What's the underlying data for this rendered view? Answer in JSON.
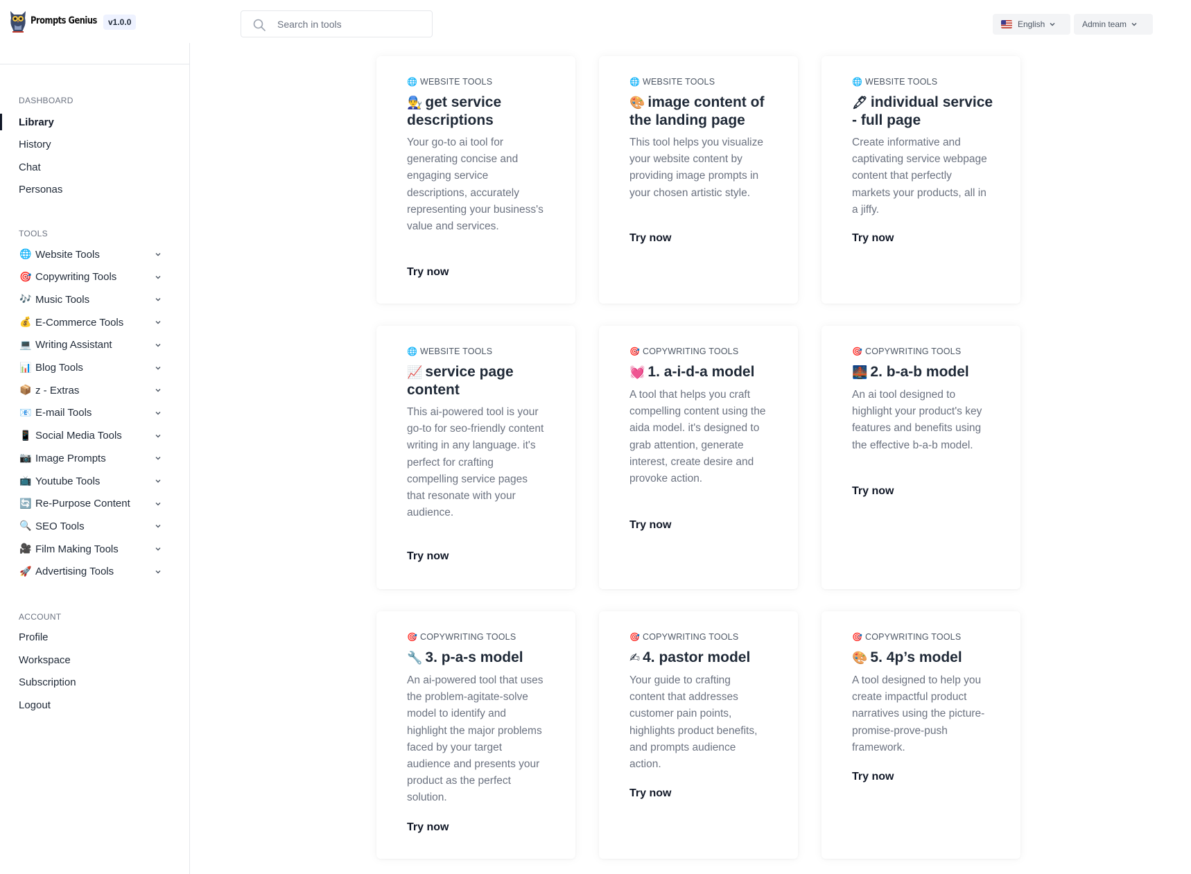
{
  "header": {
    "brand_name": "Prompts Genius",
    "version": "v1.0.0",
    "search_placeholder": "Search in tools",
    "language": "English",
    "team": "Admin team"
  },
  "sidebar": {
    "dashboard_title": "DASHBOARD",
    "dashboard_items": [
      "Library",
      "History",
      "Chat",
      "Personas"
    ],
    "tools_title": "TOOLS",
    "tools": [
      {
        "emoji": "🌐",
        "label": "Website Tools"
      },
      {
        "emoji": "🎯",
        "label": "Copywriting Tools"
      },
      {
        "emoji": "🎶",
        "label": "Music Tools"
      },
      {
        "emoji": "💰",
        "label": "E-Commerce Tools"
      },
      {
        "emoji": "💻",
        "label": "Writing Assistant"
      },
      {
        "emoji": "📊",
        "label": "Blog Tools"
      },
      {
        "emoji": "📦",
        "label": "z - Extras"
      },
      {
        "emoji": "📧",
        "label": "E-mail Tools"
      },
      {
        "emoji": "📱",
        "label": "Social Media Tools"
      },
      {
        "emoji": "📷",
        "label": "Image Prompts"
      },
      {
        "emoji": "📺",
        "label": "Youtube Tools"
      },
      {
        "emoji": "🔄",
        "label": "Re-Purpose Content"
      },
      {
        "emoji": "🔍",
        "label": "SEO Tools"
      },
      {
        "emoji": "🎥",
        "label": "Film Making Tools"
      },
      {
        "emoji": "🚀",
        "label": "Advertising Tools"
      }
    ],
    "account_title": "ACCOUNT",
    "account_items": [
      "Profile",
      "Workspace",
      "Subscription",
      "Logout"
    ]
  },
  "cards": [
    {
      "cat_emoji": "🌐",
      "category": "WEBSITE TOOLS",
      "emoji": "👨‍🔧",
      "title": "get service descriptions",
      "desc": "Your go-to ai tool for generating concise and engaging service descriptions, accurately representing your business's value and services.",
      "cta": "Try now"
    },
    {
      "cat_emoji": "🌐",
      "category": "WEBSITE TOOLS",
      "emoji": "🎨",
      "title": "image content of the landing page",
      "desc": "This tool helps you visualize your website content by providing image prompts in your chosen artistic style.",
      "cta": "Try now"
    },
    {
      "cat_emoji": "🌐",
      "category": "WEBSITE TOOLS",
      "emoji": "🖋",
      "title": "individual service - full page",
      "desc": "Create informative and captivating service webpage content that perfectly markets your products, all in a jiffy.",
      "cta": "Try now"
    },
    {
      "cat_emoji": "🌐",
      "category": "WEBSITE TOOLS",
      "emoji": "📈",
      "title": "service page content",
      "desc": "This ai-powered tool is your go-to for seo-friendly content writing in any language. it's perfect for crafting compelling service pages that resonate with your audience.",
      "cta": "Try now"
    },
    {
      "cat_emoji": "🎯",
      "category": "COPYWRITING TOOLS",
      "emoji": "💓",
      "title": "1. a-i-d-a model",
      "desc": "A tool that helps you craft compelling content using the aida model. it's designed to grab attention, generate interest, create desire and provoke action.",
      "cta": "Try now"
    },
    {
      "cat_emoji": "🎯",
      "category": "COPYWRITING TOOLS",
      "emoji": "🌉",
      "title": "2. b-a-b model",
      "desc": "An ai tool designed to highlight your product's key features and benefits using the effective b-a-b model.",
      "cta": "Try now"
    },
    {
      "cat_emoji": "🎯",
      "category": "COPYWRITING TOOLS",
      "emoji": "🔧",
      "title": "3. p-a-s model",
      "desc": "An ai-powered tool that uses the problem-agitate-solve model to identify and highlight the major problems faced by your target audience and presents your product as the perfect solution.",
      "cta": "Try now"
    },
    {
      "cat_emoji": "🎯",
      "category": "COPYWRITING TOOLS",
      "emoji": "✍",
      "title": "4. pastor model",
      "desc": "Your guide to crafting content that addresses customer pain points, highlights product benefits, and prompts audience action.",
      "cta": "Try now"
    },
    {
      "cat_emoji": "🎯",
      "category": "COPYWRITING TOOLS",
      "emoji": "🎨",
      "title": "5. 4p’s model",
      "desc": "A tool designed to help you create impactful product narratives using the picture-promise-prove-push framework.",
      "cta": "Try now"
    }
  ]
}
